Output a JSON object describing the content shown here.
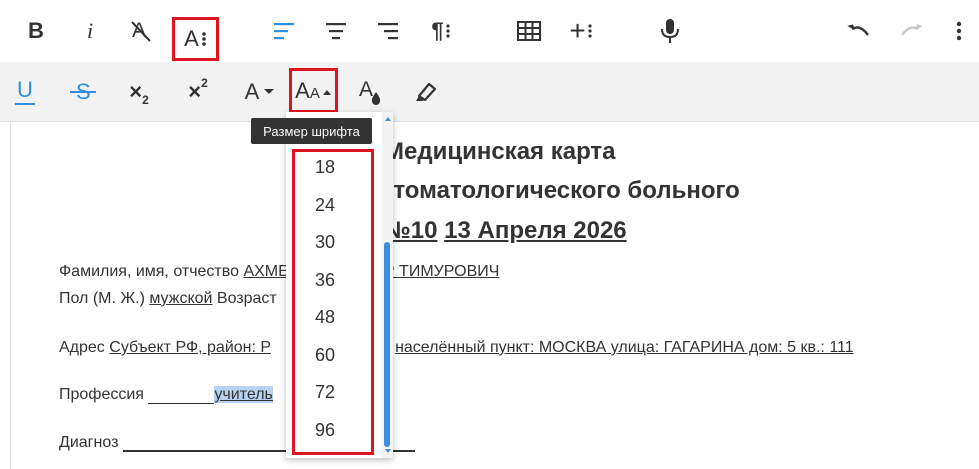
{
  "colors": {
    "accent_blue": "#2f8fe0",
    "highlight_red": "#e0141e",
    "text": "#333333",
    "disabled": "#c8c8c8",
    "toolbar_bg": "#f2f2f2",
    "tooltip_bg": "#333333"
  },
  "toolbar_row1": [
    {
      "name": "bold-button",
      "icon": "bold-icon",
      "glyph": "B"
    },
    {
      "name": "italic-button",
      "icon": "italic-icon",
      "glyph": "i"
    },
    {
      "name": "clear-format-button",
      "icon": "clear-format-icon",
      "glyph": "A"
    },
    {
      "name": "font-settings-button",
      "icon": "font-settings-icon",
      "glyph": "A",
      "highlighted": true
    },
    {
      "name": "align-left-button",
      "icon": "align-left-icon",
      "active": true
    },
    {
      "name": "align-center-button",
      "icon": "align-center-icon"
    },
    {
      "name": "align-right-button",
      "icon": "align-right-icon"
    },
    {
      "name": "paragraph-button",
      "icon": "paragraph-icon",
      "glyph": "¶"
    },
    {
      "name": "table-button",
      "icon": "table-icon"
    },
    {
      "name": "insert-more-button",
      "icon": "plus-icon",
      "glyph": "+"
    },
    {
      "name": "microphone-button",
      "icon": "microphone-icon"
    },
    {
      "name": "undo-button",
      "icon": "undo-icon"
    },
    {
      "name": "redo-button",
      "icon": "redo-icon",
      "disabled": true
    },
    {
      "name": "more-options-button",
      "icon": "more-vertical-icon"
    }
  ],
  "toolbar_row2": [
    {
      "name": "underline-button",
      "icon": "underline-icon",
      "glyph": "U",
      "active": true
    },
    {
      "name": "strikethrough-button",
      "icon": "strikethrough-icon",
      "glyph": "S",
      "active": true
    },
    {
      "name": "subscript-button",
      "icon": "subscript-icon",
      "glyph": "×",
      "sub": "2"
    },
    {
      "name": "superscript-button",
      "icon": "superscript-icon",
      "glyph": "×",
      "sup": "2"
    },
    {
      "name": "font-family-button",
      "icon": "font-family-icon",
      "glyph": "A"
    },
    {
      "name": "font-size-button",
      "icon": "font-size-icon",
      "glyph": "A",
      "glyph_small": "A",
      "highlighted": true
    },
    {
      "name": "text-color-button",
      "icon": "text-color-icon",
      "glyph": "A"
    },
    {
      "name": "highlight-button",
      "icon": "highlighter-icon"
    }
  ],
  "tooltip": "Размер шрифта",
  "font_size_options": [
    "18",
    "24",
    "30",
    "36",
    "48",
    "60",
    "72",
    "96"
  ],
  "document": {
    "title_line1": "Медицинская карта",
    "title_line2": "стоматологического больного",
    "title_number": "№10",
    "title_date": "13 Апреля 2026",
    "fio_label": "Фамилия, имя, отчество",
    "fio_value": "АХМЕДОВ МАНСУР ТИМУРОВИЧ",
    "sex_label": "Пол (М. Ж.)",
    "sex_value": "мужской",
    "age_label": "Возраст",
    "address_label": "Адрес",
    "address_value1": "Субъект РФ, район: Р",
    "address_value2": "населённый пункт: МОСКВА улица: ГАГАРИНА дом: 5 кв.: 111",
    "profession_label": "Профессия",
    "profession_value": "учитель",
    "diagnosis_label": "Диагноз"
  }
}
